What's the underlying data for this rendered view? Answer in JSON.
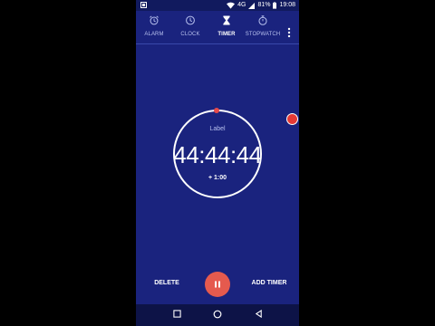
{
  "status_bar": {
    "network": "4G",
    "battery": "81%",
    "time": "19:08"
  },
  "tabs": [
    {
      "label": "ALARM",
      "icon": "alarm-icon",
      "active": false
    },
    {
      "label": "CLOCK",
      "icon": "clock-icon",
      "active": false
    },
    {
      "label": "TIMER",
      "icon": "hourglass-icon",
      "active": true
    },
    {
      "label": "STOPWATCH",
      "icon": "stopwatch-icon",
      "active": false
    }
  ],
  "timer": {
    "label": "Label",
    "time": "44:44:44",
    "add_minute": "+ 1:00",
    "progress": 1.0
  },
  "actions": {
    "delete": "DELETE",
    "add_timer": "ADD TIMER",
    "pause_icon": "pause-icon"
  },
  "colors": {
    "background": "#1a237e",
    "accent": "#e55a4e",
    "tab_inactive": "#b7c0ee"
  }
}
